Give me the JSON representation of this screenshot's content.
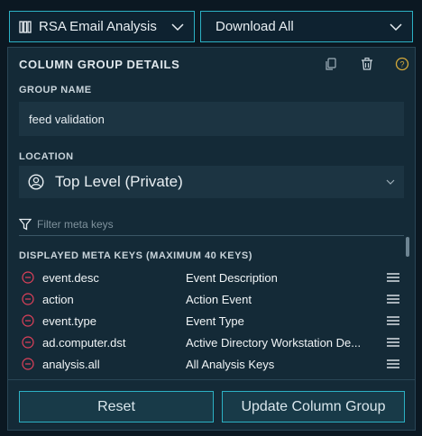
{
  "topbar": {
    "profile_label": "RSA Email Analysis",
    "download_label": "Download All"
  },
  "panel": {
    "title": "COLUMN GROUP DETAILS",
    "group_name_label": "GROUP NAME",
    "group_name_value": "feed validation",
    "location_label": "LOCATION",
    "location_value": "Top Level (Private)",
    "filter_placeholder": "Filter meta keys",
    "keys_label": "DISPLAYED META KEYS (MAXIMUM 40 KEYS)",
    "meta_keys": [
      {
        "key": "event.desc",
        "description": "Event Description"
      },
      {
        "key": "action",
        "description": "Action Event"
      },
      {
        "key": "event.type",
        "description": "Event Type"
      },
      {
        "key": "ad.computer.dst",
        "description": "Active Directory Workstation De..."
      },
      {
        "key": "analysis.all",
        "description": "All Analysis Keys"
      }
    ],
    "reset_label": "Reset",
    "update_label": "Update Column Group"
  },
  "colors": {
    "accent": "#2cb1c4",
    "remove": "#e0415a",
    "panel_bg": "#142a37",
    "page_bg": "#0b1822"
  },
  "icons": {
    "columns": "columns-icon",
    "chevron": "chevron-down-icon",
    "copy": "copy-icon",
    "trash": "trash-icon",
    "help": "help-icon",
    "user": "user-circle-icon",
    "filter": "funnel-icon",
    "remove": "remove-circle-icon",
    "drag": "drag-handle-icon"
  }
}
